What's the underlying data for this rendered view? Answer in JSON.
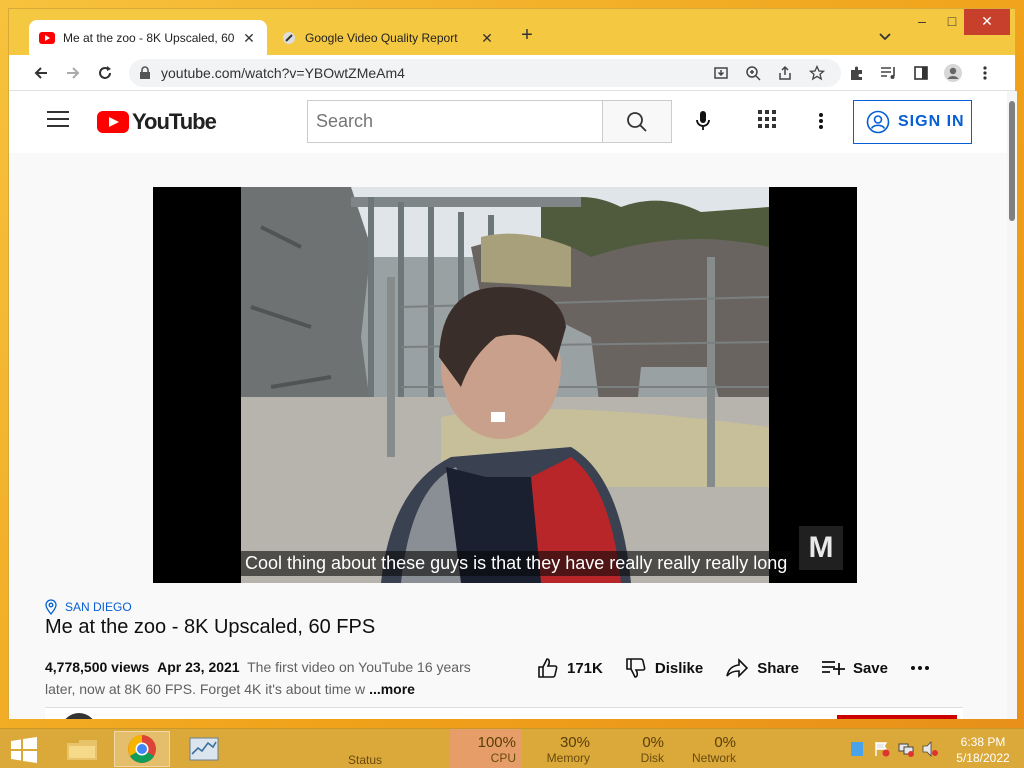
{
  "browser": {
    "tabs": [
      {
        "title": "Me at the zoo - 8K Upscaled, 60",
        "active": true
      },
      {
        "title": "Google Video Quality Report",
        "active": false
      }
    ],
    "url": "youtube.com/watch?v=YBOwtZMeAm4"
  },
  "youtube": {
    "logo_text": "YouTube",
    "search_placeholder": "Search",
    "signin_label": "SIGN IN"
  },
  "video": {
    "caption": "Cool thing about these guys is that they have really really really long",
    "watermark": "M",
    "location": "SAN DIEGO",
    "title": "Me at the zoo - 8K Upscaled, 60 FPS",
    "views": "4,778,500 views",
    "date": "Apr 23, 2021",
    "description": "The first video on YouTube 16 years later, now at 8K 60 FPS. Forget 4K it's about time w",
    "more_label": "...more",
    "likes": "171K",
    "dislike_label": "Dislike",
    "share_label": "Share",
    "save_label": "Save"
  },
  "taskbar": {
    "status_label": "Status",
    "cpu": {
      "value": "100%",
      "label": "CPU"
    },
    "memory": {
      "value": "30%",
      "label": "Memory"
    },
    "disk": {
      "value": "0%",
      "label": "Disk"
    },
    "network": {
      "value": "0%",
      "label": "Network"
    },
    "time": "6:38 PM",
    "date": "5/18/2022"
  },
  "colors": {
    "accent": "#065fd4",
    "youtube_red": "#ff0000",
    "taskbar": "#dba93a"
  }
}
